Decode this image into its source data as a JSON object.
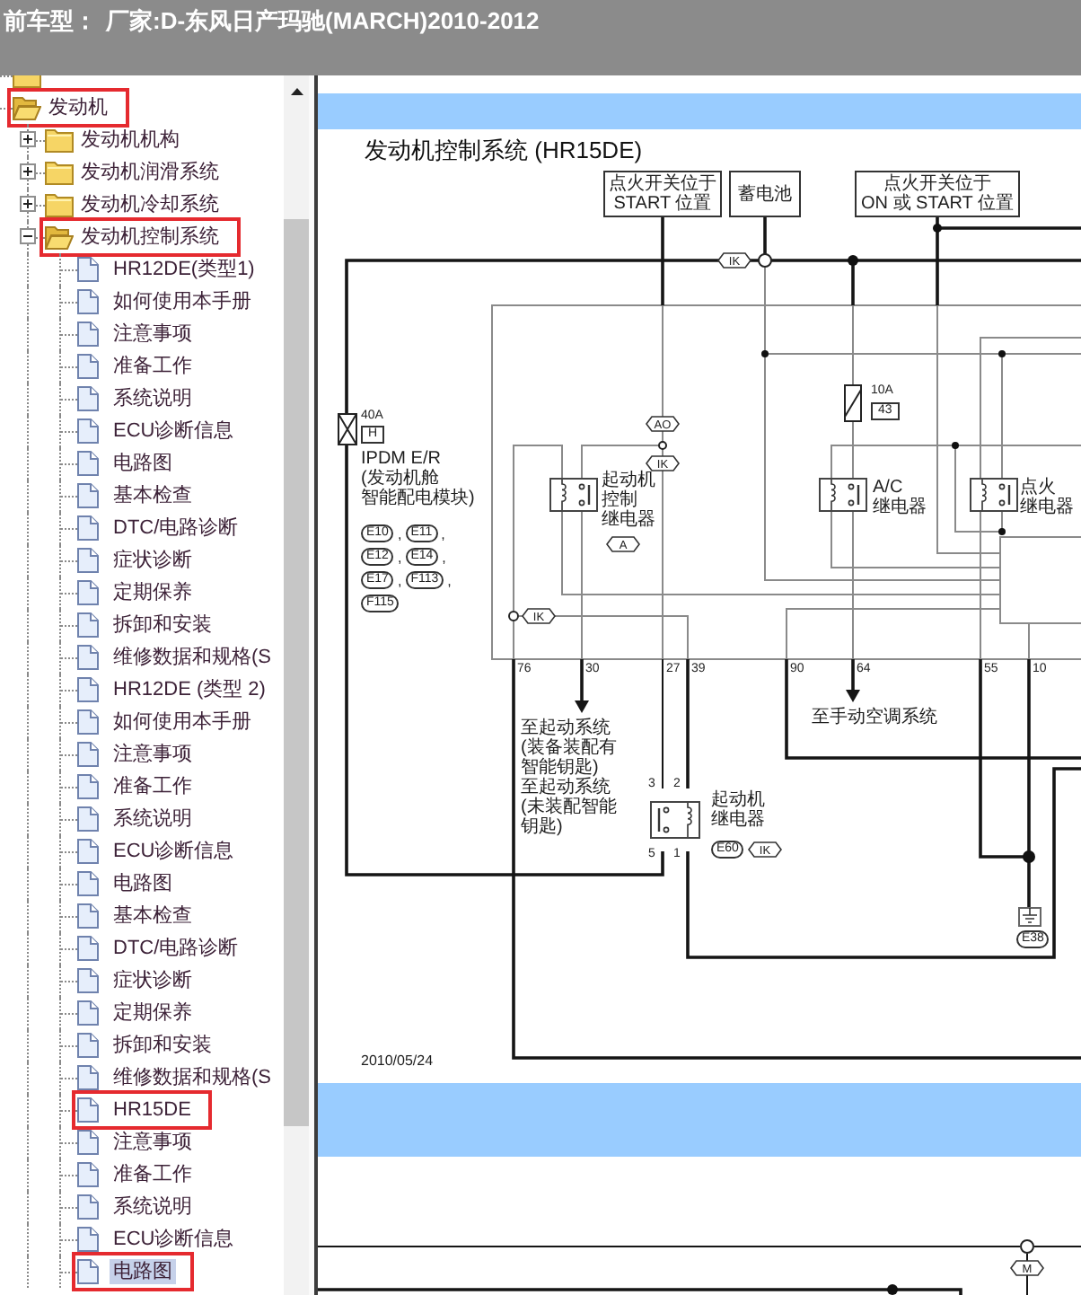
{
  "header": {
    "label": "前车型：",
    "value": "厂家:D-东风日产玛驰(MARCH)2010-2012"
  },
  "tree": [
    {
      "kind": "folder",
      "expanded": false
    },
    {
      "kind": "folder",
      "label": "发动机",
      "expanded": true,
      "selected": false,
      "highlighted": true,
      "children": [
        {
          "kind": "folder",
          "label": "发动机机构",
          "expanded": false,
          "selected": false,
          "highlighted": false
        },
        {
          "kind": "folder",
          "label": "发动机润滑系统",
          "expanded": false,
          "selected": false,
          "highlighted": false
        },
        {
          "kind": "folder",
          "label": "发动机冷却系统",
          "expanded": false,
          "selected": false,
          "highlighted": false
        },
        {
          "kind": "folder",
          "label": "发动机控制系统",
          "expanded": true,
          "selected": false,
          "highlighted": true,
          "children": [
            {
              "kind": "document",
              "label": "HR12DE(类型1)",
              "selected": false,
              "highlighted": false
            },
            {
              "kind": "document",
              "label": "如何使用本手册",
              "selected": false,
              "highlighted": false
            },
            {
              "kind": "document",
              "label": "注意事项",
              "selected": false,
              "highlighted": false
            },
            {
              "kind": "document",
              "label": "准备工作",
              "selected": false,
              "highlighted": false
            },
            {
              "kind": "document",
              "label": "系统说明",
              "selected": false,
              "highlighted": false
            },
            {
              "kind": "document",
              "label": "ECU诊断信息",
              "selected": false,
              "highlighted": false
            },
            {
              "kind": "document",
              "label": "电路图",
              "selected": false,
              "highlighted": false
            },
            {
              "kind": "document",
              "label": "基本检查",
              "selected": false,
              "highlighted": false
            },
            {
              "kind": "document",
              "label": "DTC/电路诊断",
              "selected": false,
              "highlighted": false
            },
            {
              "kind": "document",
              "label": "症状诊断",
              "selected": false,
              "highlighted": false
            },
            {
              "kind": "document",
              "label": "定期保养",
              "selected": false,
              "highlighted": false
            },
            {
              "kind": "document",
              "label": "拆卸和安装",
              "selected": false,
              "highlighted": false
            },
            {
              "kind": "document",
              "label": "维修数据和规格(S",
              "selected": false,
              "highlighted": false
            },
            {
              "kind": "document",
              "label": "HR12DE (类型 2)",
              "selected": false,
              "highlighted": false
            },
            {
              "kind": "document",
              "label": "如何使用本手册",
              "selected": false,
              "highlighted": false
            },
            {
              "kind": "document",
              "label": "注意事项",
              "selected": false,
              "highlighted": false
            },
            {
              "kind": "document",
              "label": "准备工作",
              "selected": false,
              "highlighted": false
            },
            {
              "kind": "document",
              "label": "系统说明",
              "selected": false,
              "highlighted": false
            },
            {
              "kind": "document",
              "label": "ECU诊断信息",
              "selected": false,
              "highlighted": false
            },
            {
              "kind": "document",
              "label": "电路图",
              "selected": false,
              "highlighted": false
            },
            {
              "kind": "document",
              "label": "基本检查",
              "selected": false,
              "highlighted": false
            },
            {
              "kind": "document",
              "label": "DTC/电路诊断",
              "selected": false,
              "highlighted": false
            },
            {
              "kind": "document",
              "label": "症状诊断",
              "selected": false,
              "highlighted": false
            },
            {
              "kind": "document",
              "label": "定期保养",
              "selected": false,
              "highlighted": false
            },
            {
              "kind": "document",
              "label": "拆卸和安装",
              "selected": false,
              "highlighted": false
            },
            {
              "kind": "document",
              "label": "维修数据和规格(S",
              "selected": false,
              "highlighted": false
            },
            {
              "kind": "document",
              "label": "HR15DE",
              "selected": false,
              "highlighted": true
            },
            {
              "kind": "document",
              "label": "注意事项",
              "selected": false,
              "highlighted": false
            },
            {
              "kind": "document",
              "label": "准备工作",
              "selected": false,
              "highlighted": false
            },
            {
              "kind": "document",
              "label": "系统说明",
              "selected": false,
              "highlighted": false
            },
            {
              "kind": "document",
              "label": "ECU诊断信息",
              "selected": false,
              "highlighted": false
            },
            {
              "kind": "document",
              "label": "电路图",
              "selected": true,
              "highlighted": true
            }
          ]
        }
      ]
    }
  ],
  "document": {
    "title": "发动机控制系统 (HR15DE)",
    "power_sources": [
      {
        "lines": [
          "点火开关位于",
          "START 位置"
        ]
      },
      {
        "lines": [
          "蓄电池"
        ]
      },
      {
        "lines": [
          "点火开关位于",
          "ON 或 START 位置"
        ]
      }
    ],
    "fuses": [
      {
        "rating": "40A",
        "code": "H",
        "caption": [
          "IPDM E/R",
          "(发动机舱",
          "智能配电模块)"
        ]
      },
      {
        "rating": "10A",
        "code": "43"
      }
    ],
    "relays": [
      {
        "label": [
          "起动机",
          "控制",
          "继电器"
        ],
        "tag": "A"
      },
      {
        "label": [
          "A/C",
          "继电器"
        ]
      },
      {
        "label": [
          "点火",
          "继电器"
        ]
      },
      {
        "label": [
          "起动机",
          "继电器"
        ],
        "connector": "E60",
        "tag": "IK",
        "pins": [
          "3",
          "2",
          "5",
          "1"
        ]
      }
    ],
    "harness_tags": [
      "IK",
      "AO",
      "IK",
      "IK"
    ],
    "connector_codes": [
      "E10",
      "E11",
      "E12",
      "E14",
      "E17",
      "F113",
      "F115"
    ],
    "code_separator": ",",
    "terminal_numbers": [
      "76",
      "30",
      "27",
      "39",
      "90",
      "64",
      "55",
      "10"
    ],
    "destinations": [
      [
        "至起动系统",
        "(装备装配有智能钥匙)",
        "至起动系统",
        "(未装配智能钥匙)"
      ],
      [
        "至手动空调系统"
      ]
    ],
    "ground": "E38",
    "date": "2010/05/24"
  },
  "next_page": {
    "harness_tags": [
      "M"
    ]
  }
}
